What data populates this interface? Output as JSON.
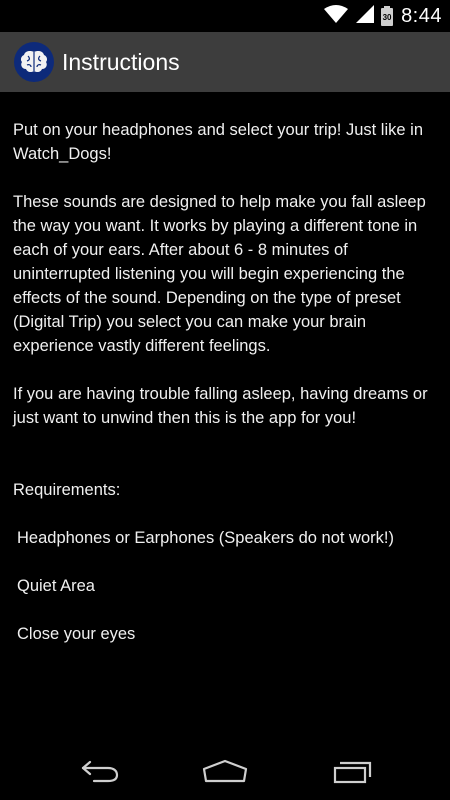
{
  "status_bar": {
    "time": "8:44",
    "battery_level": "30",
    "icons": [
      "wifi-icon",
      "cell-signal-icon",
      "battery-icon"
    ]
  },
  "action_bar": {
    "title": "Instructions",
    "app_icon": "brain-icon",
    "background": "#3d3d3d",
    "icon_color": "#0d2a7a"
  },
  "content": {
    "paragraphs": [
      "Put on your headphones and select your trip! Just like in Watch_Dogs!",
      "These sounds are designed to help make you fall asleep the way you want. It works by playing a different tone in each of your ears. After about 6 - 8 minutes of uninterrupted listening you will begin experiencing the effects of the sound. Depending on the type of preset (Digital Trip) you select you can make your brain experience vastly different feelings.",
      "If you are having trouble falling asleep, having dreams or just want to unwind then this is the app for you!"
    ],
    "requirements": {
      "title": "Requirements:",
      "items": [
        "Headphones or Earphones (Speakers do not work!)",
        "Quiet Area",
        "Close your eyes"
      ]
    }
  },
  "nav_bar": {
    "icons": [
      "back-icon",
      "home-icon",
      "recents-icon"
    ]
  }
}
